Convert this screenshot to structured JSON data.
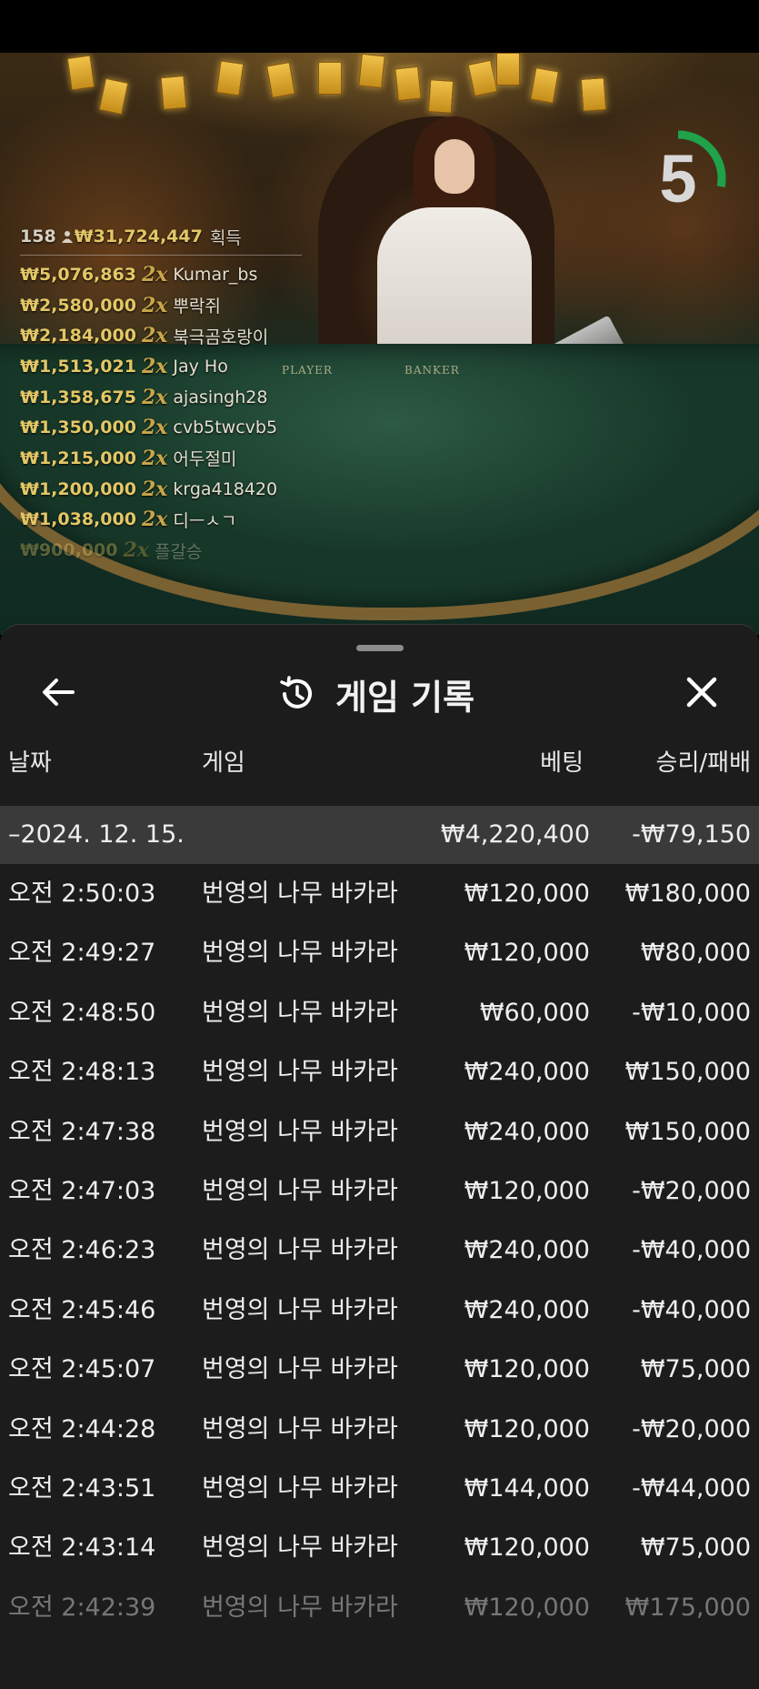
{
  "winners": {
    "count": "158",
    "total": "₩31,724,447",
    "won_label": "획득",
    "list": [
      {
        "amount": "₩5,076,863",
        "mult": "2x",
        "name": "Kumar_bs"
      },
      {
        "amount": "₩2,580,000",
        "mult": "2x",
        "name": "뿌락쥐"
      },
      {
        "amount": "₩2,184,000",
        "mult": "2x",
        "name": "북극곰호랑이"
      },
      {
        "amount": "₩1,513,021",
        "mult": "2x",
        "name": "Jay Ho"
      },
      {
        "amount": "₩1,358,675",
        "mult": "2x",
        "name": "ajasingh28"
      },
      {
        "amount": "₩1,350,000",
        "mult": "2x",
        "name": "cvb5twcvb5"
      },
      {
        "amount": "₩1,215,000",
        "mult": "2x",
        "name": "어두절미"
      },
      {
        "amount": "₩1,200,000",
        "mult": "2x",
        "name": "krga418420"
      },
      {
        "amount": "₩1,038,000",
        "mult": "2x",
        "name": "디ㅡㅅㄱ"
      },
      {
        "amount": "₩900,000",
        "mult": "2x",
        "name": "플갈승"
      }
    ]
  },
  "table_labels": {
    "player": "PLAYER",
    "banker": "BANKER"
  },
  "timer": {
    "value": "5",
    "progress": 0.28,
    "color": "#1fa24a"
  },
  "panel": {
    "title": "게임 기록",
    "icons": {
      "back": "arrow-left-icon",
      "history": "history-clock-icon",
      "close": "close-icon"
    },
    "columns": {
      "date": "날짜",
      "game": "게임",
      "bet": "베팅",
      "result": "승리/패배"
    },
    "date_group": {
      "date": "–2024. 12. 15.",
      "bet": "₩4,220,400",
      "result": "-₩79,150"
    },
    "rows": [
      {
        "time": "오전 2:50:03",
        "game": "번영의 나무 바카라",
        "bet": "₩120,000",
        "result": "₩180,000"
      },
      {
        "time": "오전 2:49:27",
        "game": "번영의 나무 바카라",
        "bet": "₩120,000",
        "result": "₩80,000"
      },
      {
        "time": "오전 2:48:50",
        "game": "번영의 나무 바카라",
        "bet": "₩60,000",
        "result": "-₩10,000"
      },
      {
        "time": "오전 2:48:13",
        "game": "번영의 나무 바카라",
        "bet": "₩240,000",
        "result": "₩150,000"
      },
      {
        "time": "오전 2:47:38",
        "game": "번영의 나무 바카라",
        "bet": "₩240,000",
        "result": "₩150,000"
      },
      {
        "time": "오전 2:47:03",
        "game": "번영의 나무 바카라",
        "bet": "₩120,000",
        "result": "-₩20,000"
      },
      {
        "time": "오전 2:46:23",
        "game": "번영의 나무 바카라",
        "bet": "₩240,000",
        "result": "-₩40,000"
      },
      {
        "time": "오전 2:45:46",
        "game": "번영의 나무 바카라",
        "bet": "₩240,000",
        "result": "-₩40,000"
      },
      {
        "time": "오전 2:45:07",
        "game": "번영의 나무 바카라",
        "bet": "₩120,000",
        "result": "₩75,000"
      },
      {
        "time": "오전 2:44:28",
        "game": "번영의 나무 바카라",
        "bet": "₩120,000",
        "result": "-₩20,000"
      },
      {
        "time": "오전 2:43:51",
        "game": "번영의 나무 바카라",
        "bet": "₩144,000",
        "result": "-₩44,000"
      },
      {
        "time": "오전 2:43:14",
        "game": "번영의 나무 바카라",
        "bet": "₩120,000",
        "result": "₩75,000"
      },
      {
        "time": "오전 2:42:39",
        "game": "번영의 나무 바카라",
        "bet": "₩120,000",
        "result": "₩175,000"
      }
    ]
  }
}
